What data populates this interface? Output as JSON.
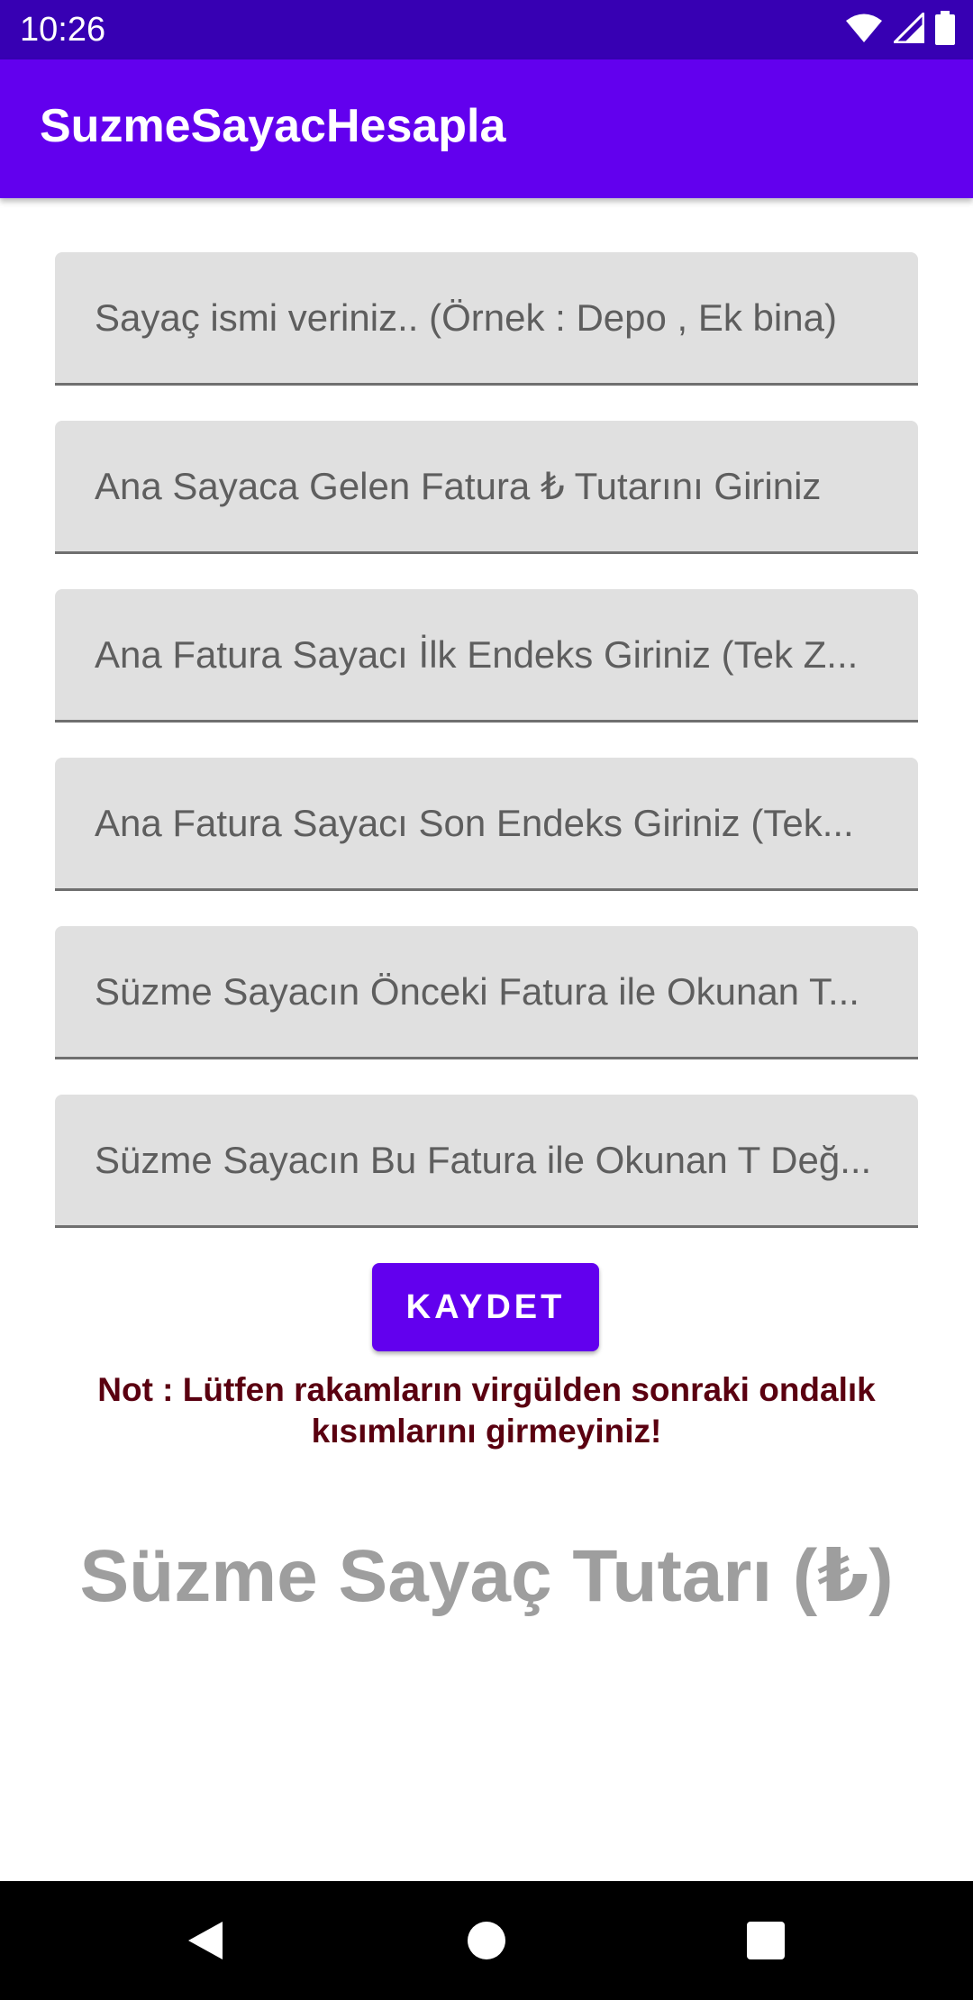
{
  "status_bar": {
    "time": "10:26",
    "icons": [
      "wifi-icon",
      "signal-icon",
      "battery-icon"
    ]
  },
  "app_bar": {
    "title": "SuzmeSayacHesapla"
  },
  "form": {
    "fields": [
      {
        "placeholder": "Sayaç ismi veriniz.. (Örnek : Depo , Ek bina)"
      },
      {
        "placeholder": "Ana Sayaca Gelen Fatura ₺ Tutarını Giriniz"
      },
      {
        "placeholder": "Ana Fatura Sayacı İlk Endeks Giriniz (Tek Z..."
      },
      {
        "placeholder": "Ana Fatura Sayacı Son Endeks Giriniz (Tek..."
      },
      {
        "placeholder": "Süzme Sayacın Önceki Fatura ile Okunan T..."
      },
      {
        "placeholder": "Süzme Sayacın Bu Fatura ile Okunan T Değ..."
      }
    ],
    "save_label": "KAYDET",
    "note": "Not : Lütfen rakamların virgülden sonraki ondalık kısımlarını girmeyiniz!",
    "result_label": "Süzme Sayaç Tutarı (₺)"
  },
  "nav_bar": {
    "icons": [
      "back-icon",
      "home-icon",
      "recents-icon"
    ]
  },
  "colors": {
    "status_bar": "#3700b3",
    "primary": "#6200ee",
    "field_bg": "#e0e0e0",
    "note_text": "#5a0010",
    "result_text": "#9e9e9e"
  }
}
